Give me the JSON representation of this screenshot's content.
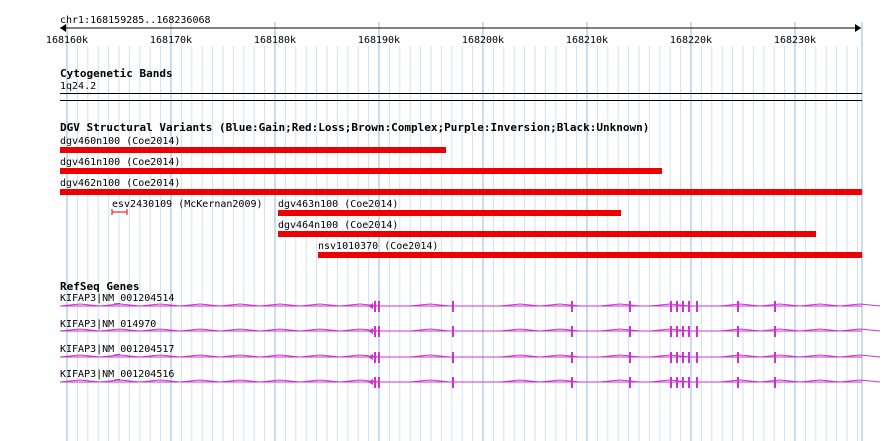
{
  "ruler": {
    "range_label": "chr1:168159285..168236068",
    "ticks": [
      "168160k",
      "168170k",
      "168180k",
      "168190k",
      "168200k",
      "168210k",
      "168220k",
      "168230k"
    ]
  },
  "cyto": {
    "title": "Cytogenetic Bands",
    "band": "1q24.2"
  },
  "dgv": {
    "title": "DGV Structural Variants (Blue:Gain;Red:Loss;Brown:Complex;Purple:Inversion;Black:Unknown)",
    "loss_color": "#ee0000",
    "variants": [
      {
        "label": "dgv460n100 (Coe2014)"
      },
      {
        "label": "dgv461n100 (Coe2014)"
      },
      {
        "label": "dgv462n100 (Coe2014)"
      },
      {
        "label": "esv2430109 (McKernan2009)"
      },
      {
        "label": "dgv463n100 (Coe2014)"
      },
      {
        "label": "dgv464n100 (Coe2014)"
      },
      {
        "label": "nsv1010370 (Coe2014)"
      }
    ]
  },
  "refseq": {
    "title": "RefSeq Genes",
    "gene_color": "#cc33cc",
    "transcripts": [
      {
        "label": "KIFAP3|NM_001204514"
      },
      {
        "label": "KIFAP3|NM_014970"
      },
      {
        "label": "KIFAP3|NM_001204517"
      },
      {
        "label": "KIFAP3|NM_001204516"
      }
    ]
  }
}
